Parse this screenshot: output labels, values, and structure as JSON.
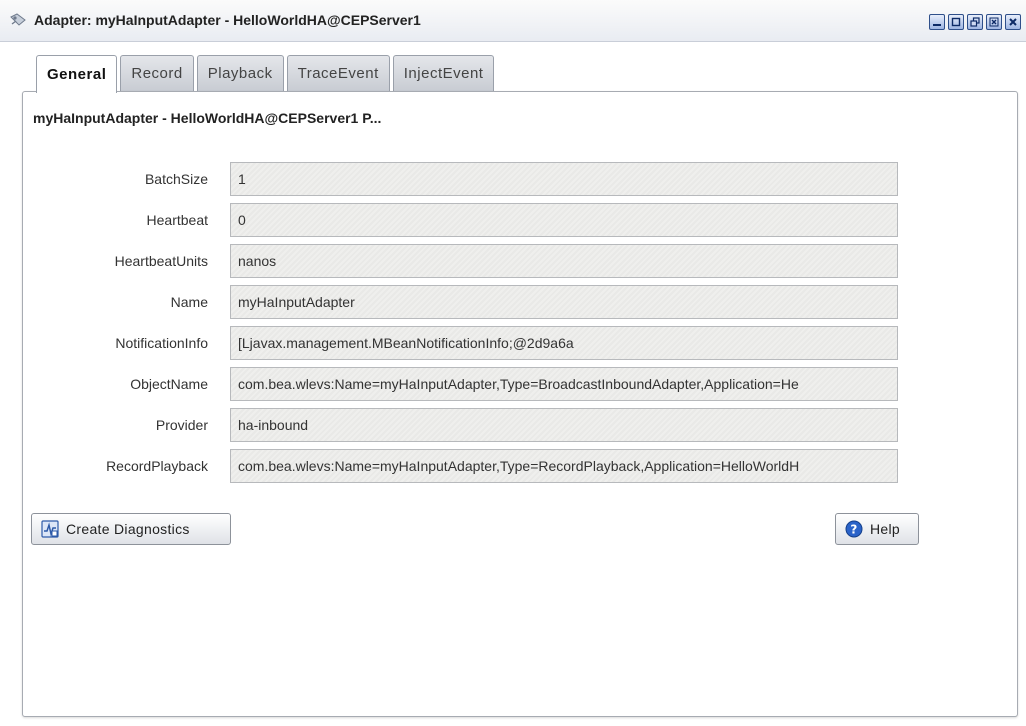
{
  "window": {
    "title": "Adapter: myHaInputAdapter - HelloWorldHA@CEPServer1",
    "icon": "adapter-icon",
    "controls": [
      "minimize-icon",
      "maximize-icon",
      "restore-icon",
      "close-icon",
      "close-all-icon"
    ]
  },
  "tabs": [
    {
      "label": "General",
      "active": true
    },
    {
      "label": "Record",
      "active": false
    },
    {
      "label": "Playback",
      "active": false
    },
    {
      "label": "TraceEvent",
      "active": false
    },
    {
      "label": "InjectEvent",
      "active": false
    }
  ],
  "panel": {
    "title": "myHaInputAdapter - HelloWorldHA@CEPServer1 P..."
  },
  "fields": [
    {
      "label": "BatchSize",
      "value": "1"
    },
    {
      "label": "Heartbeat",
      "value": "0"
    },
    {
      "label": "HeartbeatUnits",
      "value": "nanos"
    },
    {
      "label": "Name",
      "value": "myHaInputAdapter"
    },
    {
      "label": "NotificationInfo",
      "value": "[Ljavax.management.MBeanNotificationInfo;@2d9a6a"
    },
    {
      "label": "ObjectName",
      "value": "com.bea.wlevs:Name=myHaInputAdapter,Type=BroadcastInboundAdapter,Application=He"
    },
    {
      "label": "Provider",
      "value": "ha-inbound"
    },
    {
      "label": "RecordPlayback",
      "value": "com.bea.wlevs:Name=myHaInputAdapter,Type=RecordPlayback,Application=HelloWorldH"
    }
  ],
  "buttons": {
    "create_diagnostics": {
      "label": "Create Diagnostics",
      "icon": "diagnostics-icon"
    },
    "help": {
      "label": "Help",
      "icon": "help-icon"
    }
  },
  "colors": {
    "titlebar": "#e9ecf2",
    "window_button": "#9fb6e3",
    "help_icon": "#2a63c9"
  }
}
